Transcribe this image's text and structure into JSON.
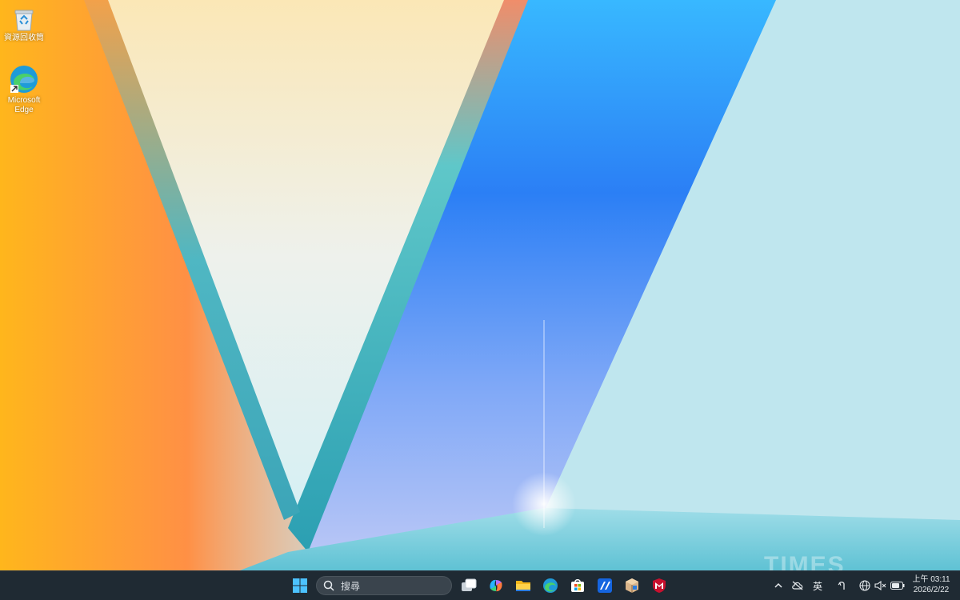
{
  "desktop": {
    "icons": [
      {
        "label": "資源回收筒",
        "icon": "recycle-bin-icon"
      },
      {
        "label": "Microsoft Edge",
        "icon": "edge-icon"
      }
    ]
  },
  "taskbar": {
    "start_icon": "windows-start-icon",
    "search": {
      "label": "搜尋",
      "icon": "search-icon"
    },
    "pinned": [
      {
        "icon": "task-view-icon"
      },
      {
        "icon": "copilot-icon"
      },
      {
        "icon": "file-explorer-icon"
      },
      {
        "icon": "edge-icon"
      },
      {
        "icon": "microsoft-store-icon"
      },
      {
        "icon": "app-icon"
      },
      {
        "icon": "package-icon"
      },
      {
        "icon": "mcafee-icon"
      }
    ]
  },
  "tray": {
    "chevron_icon": "chevron-up-icon",
    "ime_label": "英",
    "ime_mode_icon": "ime-mode-icon",
    "network_icon": "globe-icon",
    "volume_icon": "volume-muted-icon",
    "battery_icon": "battery-icon",
    "time": "上午 03:11",
    "date": "2026/2/22"
  },
  "watermark": "TIMES",
  "colors": {
    "taskbar": "#1f2a33",
    "accent": "#0a84ff",
    "mcafee": "#c8102e"
  }
}
